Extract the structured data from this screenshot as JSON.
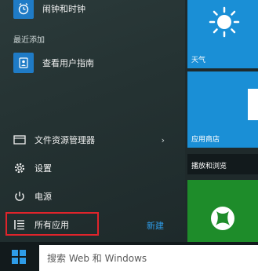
{
  "recent_top": {
    "label": "闹钟和时钟",
    "icon": "alarm-clock-icon",
    "color": "#1f7bc6"
  },
  "recently_added": {
    "section_label": "最近添加",
    "item": {
      "label": "查看用户指南",
      "icon": "user-guide-icon",
      "color": "#1f7bc6"
    }
  },
  "system": {
    "explorer": {
      "label": "文件资源管理器",
      "icon": "folder-icon",
      "chevron": "›"
    },
    "settings": {
      "label": "设置",
      "icon": "gear-icon"
    },
    "power": {
      "label": "电源",
      "icon": "power-icon"
    },
    "all_apps": {
      "label": "所有应用",
      "icon": "list-icon"
    },
    "new": "新建"
  },
  "tiles": [
    {
      "label": "天气",
      "icon": "sun-icon",
      "color": "#1a8fd6"
    },
    {
      "label": "应用商店",
      "icon": "store-icon",
      "color": "#1a8fd6"
    },
    {
      "label": "播放和浏览",
      "icon": "",
      "color": "#121a1c"
    },
    {
      "label": "",
      "icon": "xbox-icon",
      "color": "#1e8c2a"
    }
  ],
  "taskbar": {
    "search_placeholder": "搜索 Web 和 Windows",
    "start_icon": "windows-logo-icon"
  },
  "colors": {
    "accent": "#1a8fd6",
    "highlight_border": "#e0242b",
    "new_link": "#2e9ce8"
  }
}
